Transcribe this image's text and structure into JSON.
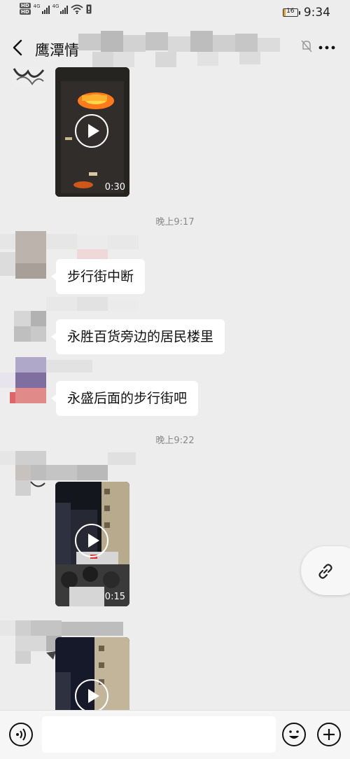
{
  "status_bar": {
    "network_badges": [
      "HD",
      "HD"
    ],
    "signal_labels": [
      "4G",
      "4G"
    ],
    "battery_level": "16",
    "clock": "9:34"
  },
  "nav": {
    "title": "鹰潭情",
    "icons": [
      "back-arrow-icon",
      "mute-icon",
      "more-icon"
    ]
  },
  "messages": {
    "video_1_duration": "0:30",
    "time_1": "晚上9:17",
    "text_1": "步行街中断",
    "text_2": "永胜百货旁边的居民楼里",
    "text_3": "永盛后面的步行街吧",
    "time_2": "晚上9:22",
    "video_2_duration": "0:15"
  },
  "input_bar": {
    "message_value": "",
    "icons": [
      "voice-icon",
      "emoji-icon",
      "plus-icon"
    ]
  },
  "floating": {
    "icon": "link-icon"
  }
}
